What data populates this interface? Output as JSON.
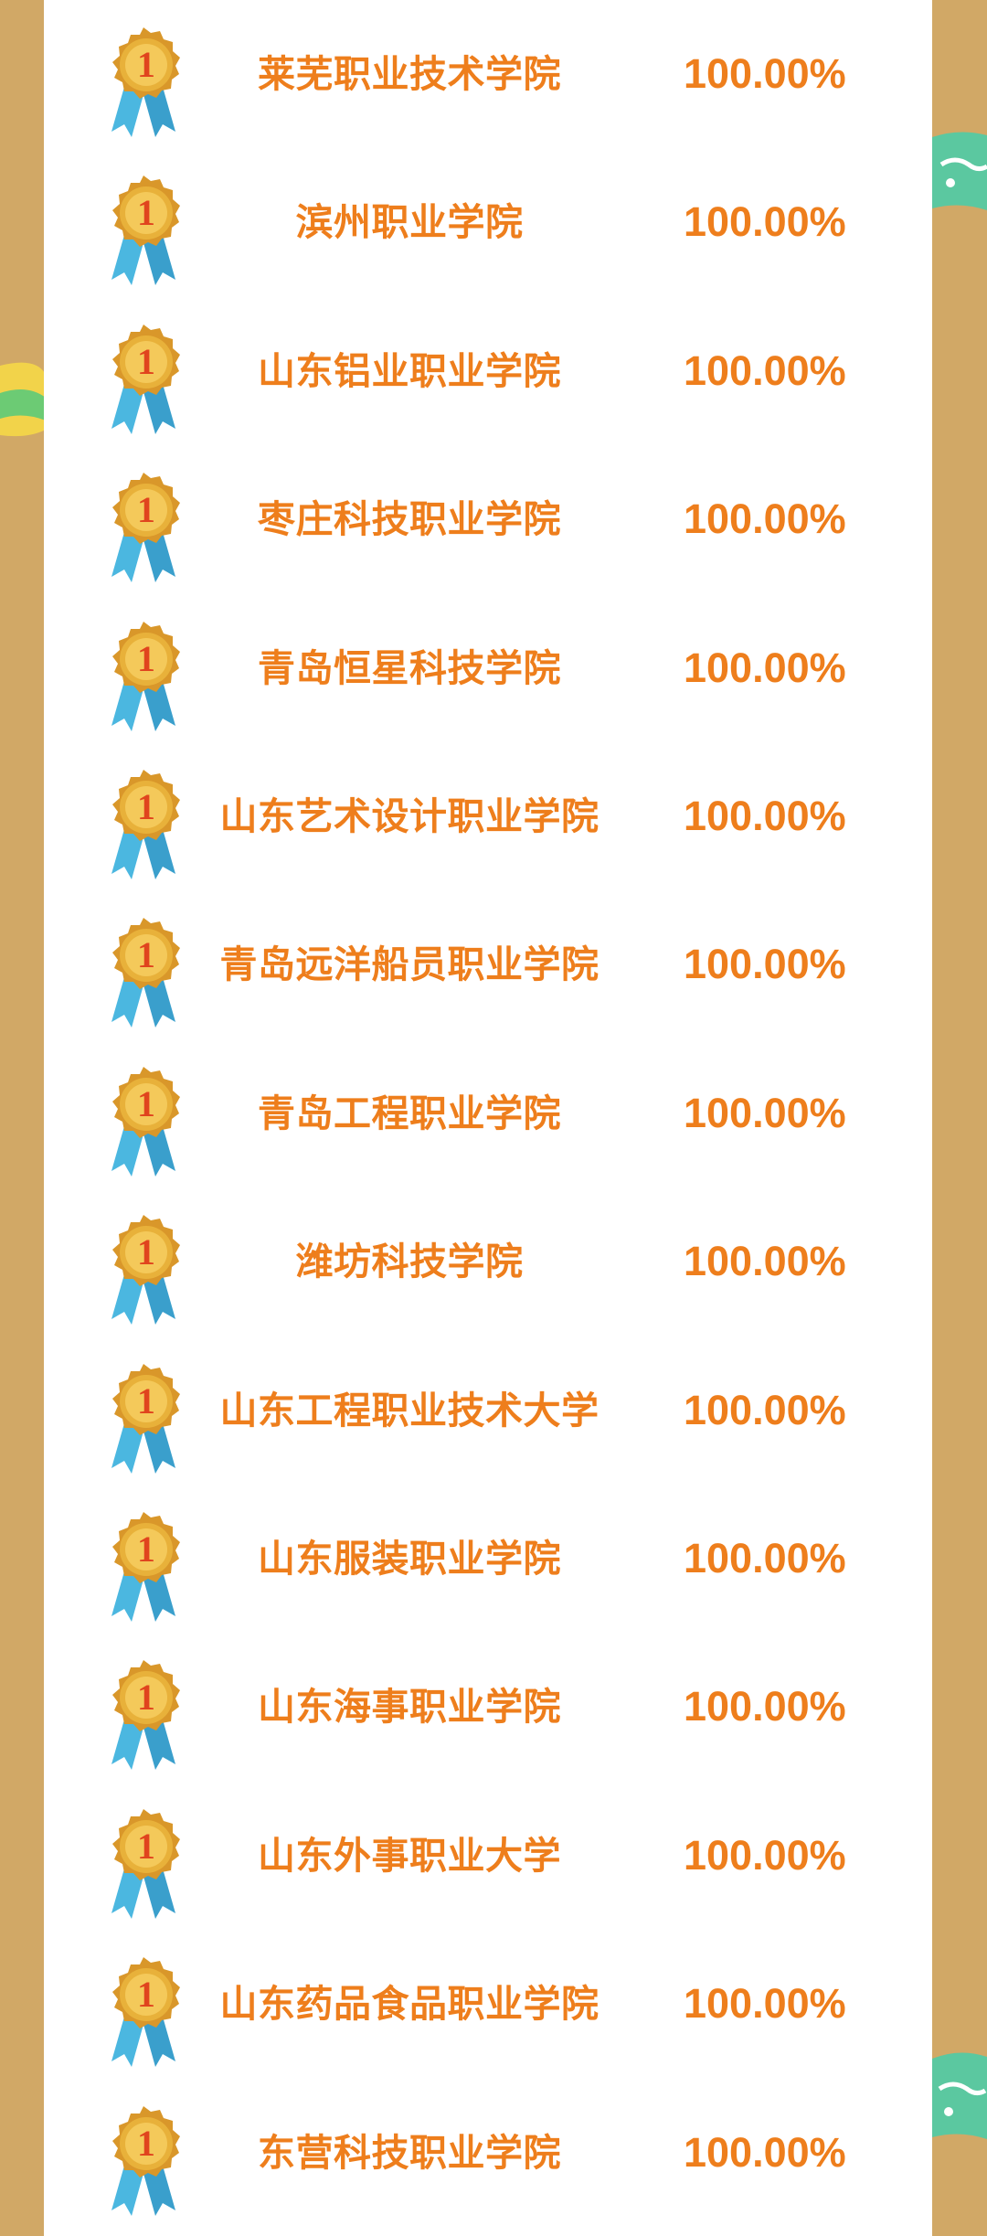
{
  "colors": {
    "background": "#D1A866",
    "panel": "#FFFFFF",
    "text_orange": "#EE7E1C",
    "medal_gold": "#E8B13A",
    "medal_numeral": "#E0441E",
    "ribbon_blue": "#4BB7E0"
  },
  "medal": {
    "icon": "gold-medal-icon",
    "numeral": "1"
  },
  "rows": [
    {
      "school": "莱芜职业技术学院",
      "rate": "100.00%"
    },
    {
      "school": "滨州职业学院",
      "rate": "100.00%"
    },
    {
      "school": "山东铝业职业学院",
      "rate": "100.00%"
    },
    {
      "school": "枣庄科技职业学院",
      "rate": "100.00%"
    },
    {
      "school": "青岛恒星科技学院",
      "rate": "100.00%"
    },
    {
      "school": "山东艺术设计职业学院",
      "rate": "100.00%"
    },
    {
      "school": "青岛远洋船员职业学院",
      "rate": "100.00%"
    },
    {
      "school": "青岛工程职业学院",
      "rate": "100.00%"
    },
    {
      "school": "潍坊科技学院",
      "rate": "100.00%"
    },
    {
      "school": "山东工程职业技术大学",
      "rate": "100.00%"
    },
    {
      "school": "山东服装职业学院",
      "rate": "100.00%"
    },
    {
      "school": "山东海事职业学院",
      "rate": "100.00%"
    },
    {
      "school": "山东外事职业大学",
      "rate": "100.00%"
    },
    {
      "school": "山东药品食品职业学院",
      "rate": "100.00%"
    },
    {
      "school": "东营科技职业学院",
      "rate": "100.00%"
    }
  ]
}
